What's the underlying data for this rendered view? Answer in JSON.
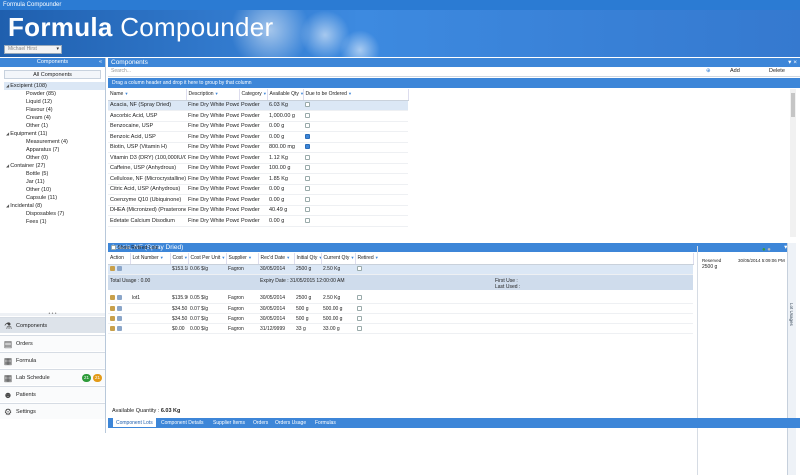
{
  "window": {
    "title": "Formula Compounder"
  },
  "banner": {
    "app_name_bold": "Formula",
    "app_name_light": "Compounder",
    "user_name": "Michael Hirst"
  },
  "left_panel": {
    "title": "Components",
    "all_components": "All Components",
    "tree": [
      {
        "type": "cat",
        "label": "Excipient (108)",
        "selected": true
      },
      {
        "type": "sub",
        "label": "Powder (85)"
      },
      {
        "type": "sub",
        "label": "Liquid (12)"
      },
      {
        "type": "sub",
        "label": "Flavour (4)"
      },
      {
        "type": "sub",
        "label": "Cream (4)"
      },
      {
        "type": "sub",
        "label": "Other (1)"
      },
      {
        "type": "cat",
        "label": "Equipment (11)"
      },
      {
        "type": "sub",
        "label": "Measurement (4)"
      },
      {
        "type": "sub",
        "label": "Apparatus (7)"
      },
      {
        "type": "sub",
        "label": "Other (0)"
      },
      {
        "type": "cat",
        "label": "Container (27)"
      },
      {
        "type": "sub",
        "label": "Bottle (5)"
      },
      {
        "type": "sub",
        "label": "Jar (11)"
      },
      {
        "type": "sub",
        "label": "Other (10)"
      },
      {
        "type": "sub",
        "label": "Capsule (11)"
      },
      {
        "type": "cat",
        "label": "Incidental (8)"
      },
      {
        "type": "sub",
        "label": "Disposables (7)"
      },
      {
        "type": "sub",
        "label": "Fees (1)"
      }
    ],
    "nav": [
      {
        "label": "Components",
        "icon": "flask-icon",
        "active": true
      },
      {
        "label": "Orders",
        "icon": "orders-icon"
      },
      {
        "label": "Formula",
        "icon": "formula-icon"
      },
      {
        "label": "Lab Schedule",
        "icon": "calendar-icon",
        "badges": [
          "21",
          "21"
        ]
      },
      {
        "label": "Patients",
        "icon": "patient-icon"
      },
      {
        "label": "Settings",
        "icon": "gear-icon"
      }
    ]
  },
  "components": {
    "title": "Components",
    "search_placeholder": "Search...",
    "add_label": "Add",
    "delete_label": "Delete",
    "group_hint": "Drag a column header and drop it here to group by that column",
    "columns": [
      "Name",
      "Description",
      "Category",
      "Available Qty",
      "Due to be Ordered"
    ],
    "rows": [
      {
        "name": "Acacia, NF (Spray Dried)",
        "desc": "Fine Dry White Powder",
        "cat": "Powder",
        "qty": "6.03 Kg",
        "due": false,
        "selected": true
      },
      {
        "name": "Ascorbic Acid, USP",
        "desc": "Fine Dry White Powder",
        "cat": "Powder",
        "qty": "1,000.00 g",
        "due": false
      },
      {
        "name": "Benzocaine, USP",
        "desc": "Fine Dry White Powder",
        "cat": "Powder",
        "qty": "0.00 g",
        "due": false
      },
      {
        "name": "Benzoic Acid, USP",
        "desc": "Fine Dry White Powder",
        "cat": "Powder",
        "qty": "0.00 g",
        "due": true
      },
      {
        "name": "Biotin, USP (Vitamin H)",
        "desc": "Fine Dry White Powder",
        "cat": "Powder",
        "qty": "800.00 mg",
        "due": true
      },
      {
        "name": "Vitamin D3 (DRY) (100,000IU/GM)",
        "desc": "Fine Dry White Powder",
        "cat": "Powder",
        "qty": "1.12 Kg",
        "due": false
      },
      {
        "name": "Caffeine, USP (Anhydrous)",
        "desc": "Fine Dry White Powder",
        "cat": "Powder",
        "qty": "100.00 g",
        "due": false
      },
      {
        "name": "Cellulose, NF (Microcrystalline)",
        "desc": "Fine Dry White Powder",
        "cat": "Powder",
        "qty": "1.85 Kg",
        "due": false
      },
      {
        "name": "Citric Acid, USP (Anhydrous)",
        "desc": "Fine Dry White Powder",
        "cat": "Powder",
        "qty": "0.00 g",
        "due": false
      },
      {
        "name": "Coenzyme Q10 (Ubiquinone)",
        "desc": "Fine Dry White Powder",
        "cat": "Powder",
        "qty": "0.00 g",
        "due": false
      },
      {
        "name": "DHEA (Micronized) (Prasterone)",
        "desc": "Fine Dry White Powder",
        "cat": "Powder",
        "qty": "40.49 g",
        "due": false
      },
      {
        "name": "Edetate Calcium Disodium",
        "desc": "Fine Dry White Powder",
        "cat": "Powder",
        "qty": "0.00 g",
        "due": false
      }
    ]
  },
  "lots": {
    "title": "Acacia, NF (Spray Dried)",
    "show_retired": "Show Retired Lots",
    "columns": [
      "Action",
      "Lot Number",
      "Cost",
      "Cost Per Unit",
      "Supplier",
      "Rec'd Date",
      "Initial Qty",
      "Current Qty",
      "Retired"
    ],
    "first_row": {
      "lot": "",
      "cost": "$153.18",
      "cpu": "0.06 $/g",
      "supplier": "Fagron",
      "date": "30/05/2014",
      "initial": "2500 g",
      "current": "2.50 Kg"
    },
    "detail": {
      "total_usage": "Total Usage : 0.00",
      "expiry": "Expiry Date : 31/05/2015 12:00:00 AM",
      "first_use": "First Use :",
      "last_used": "Last Used :"
    },
    "rows": [
      {
        "lot": "lot1",
        "cost": "$135.90",
        "cpu": "0.05 $/g",
        "supplier": "Fagron",
        "date": "30/05/2014",
        "initial": "2500 g",
        "current": "2.50 Kg"
      },
      {
        "lot": "",
        "cost": "$34.50",
        "cpu": "0.07 $/g",
        "supplier": "Fagron",
        "date": "30/05/2014",
        "initial": "500 g",
        "current": "500.00 g"
      },
      {
        "lot": "",
        "cost": "$34.50",
        "cpu": "0.07 $/g",
        "supplier": "Fagron",
        "date": "30/05/2014",
        "initial": "500 g",
        "current": "500.00 g"
      },
      {
        "lot": "",
        "cost": "$0.00",
        "cpu": "0.00 $/g",
        "supplier": "Fagron",
        "date": "31/12/9999",
        "initial": "33 g",
        "current": "33.00 g"
      }
    ],
    "reserved": {
      "label": "Reserved",
      "timestamp": "30/05/2014 5:09:06 PM",
      "qty": "2500 g"
    },
    "lot_usages_label": "Lot Usages",
    "available_qty_label": "Available Quantity :",
    "available_qty_value": "6.03 Kg",
    "tabs": [
      "Component Lots",
      "Component Details",
      "Supplier Items",
      "Orders",
      "Orders Usage",
      "Formulas"
    ]
  },
  "colors": {
    "accent": "#3d86d8",
    "banner": "#2b7bd3",
    "badge_green": "#2e9b3a",
    "badge_orange": "#e39a17"
  }
}
